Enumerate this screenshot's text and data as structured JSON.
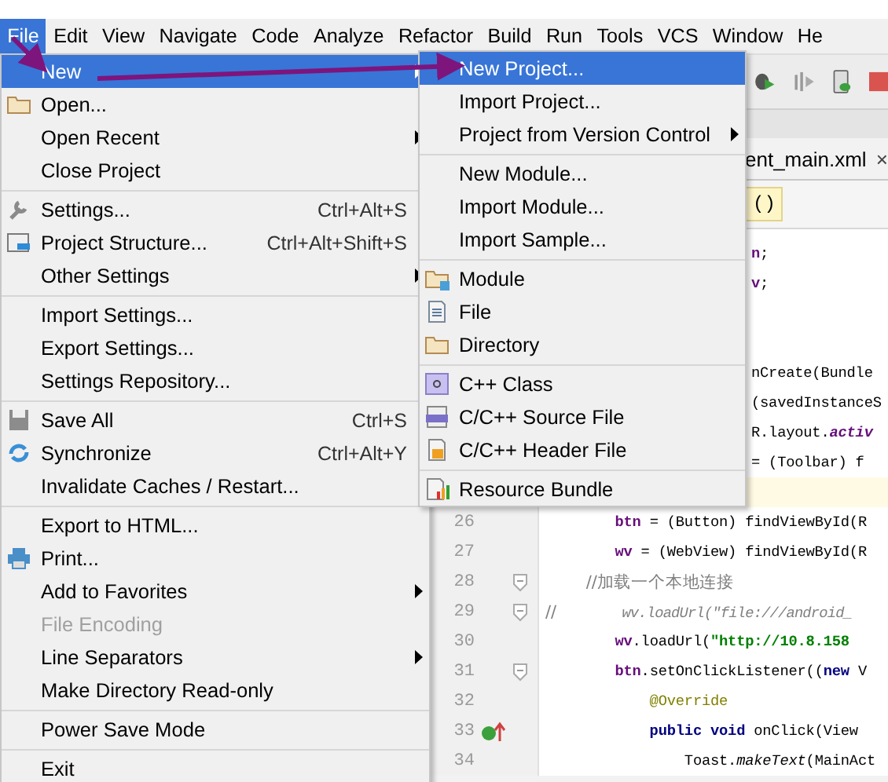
{
  "menu_bar": [
    {
      "label": "File",
      "selected": true
    },
    {
      "label": "Edit",
      "selected": false
    },
    {
      "label": "View",
      "selected": false
    },
    {
      "label": "Navigate",
      "selected": false
    },
    {
      "label": "Code",
      "selected": false
    },
    {
      "label": "Analyze",
      "selected": false
    },
    {
      "label": "Refactor",
      "selected": false
    },
    {
      "label": "Build",
      "selected": false
    },
    {
      "label": "Run",
      "selected": false
    },
    {
      "label": "Tools",
      "selected": false
    },
    {
      "label": "VCS",
      "selected": false
    },
    {
      "label": "Window",
      "selected": false
    },
    {
      "label": "He",
      "selected": false
    }
  ],
  "file_menu": [
    {
      "kind": "item",
      "label": "New",
      "submenu": true,
      "selected": true,
      "disabled": false
    },
    {
      "kind": "item",
      "label": "Open...",
      "selected": false,
      "disabled": false
    },
    {
      "kind": "item",
      "label": "Open Recent",
      "submenu": true,
      "selected": false,
      "disabled": false
    },
    {
      "kind": "item",
      "label": "Close Project",
      "selected": false,
      "disabled": false
    },
    {
      "kind": "separator"
    },
    {
      "kind": "item",
      "label": "Settings...",
      "shortcut": "Ctrl+Alt+S",
      "selected": false,
      "disabled": false
    },
    {
      "kind": "item",
      "label": "Project Structure...",
      "shortcut": "Ctrl+Alt+Shift+S",
      "selected": false,
      "disabled": false
    },
    {
      "kind": "item",
      "label": "Other Settings",
      "submenu": true,
      "selected": false,
      "disabled": false
    },
    {
      "kind": "separator"
    },
    {
      "kind": "item",
      "label": "Import Settings...",
      "selected": false,
      "disabled": false
    },
    {
      "kind": "item",
      "label": "Export Settings...",
      "selected": false,
      "disabled": false
    },
    {
      "kind": "item",
      "label": "Settings Repository...",
      "selected": false,
      "disabled": false
    },
    {
      "kind": "separator"
    },
    {
      "kind": "item",
      "label": "Save All",
      "shortcut": "Ctrl+S",
      "selected": false,
      "disabled": false
    },
    {
      "kind": "item",
      "label": "Synchronize",
      "shortcut": "Ctrl+Alt+Y",
      "selected": false,
      "disabled": false
    },
    {
      "kind": "item",
      "label": "Invalidate Caches / Restart...",
      "selected": false,
      "disabled": false
    },
    {
      "kind": "separator"
    },
    {
      "kind": "item",
      "label": "Export to HTML...",
      "selected": false,
      "disabled": false
    },
    {
      "kind": "item",
      "label": "Print...",
      "selected": false,
      "disabled": false
    },
    {
      "kind": "item",
      "label": "Add to Favorites",
      "submenu": true,
      "selected": false,
      "disabled": false
    },
    {
      "kind": "item",
      "label": "File Encoding",
      "selected": false,
      "disabled": true
    },
    {
      "kind": "item",
      "label": "Line Separators",
      "submenu": true,
      "selected": false,
      "disabled": false
    },
    {
      "kind": "item",
      "label": "Make Directory Read-only",
      "selected": false,
      "disabled": false
    },
    {
      "kind": "separator"
    },
    {
      "kind": "item",
      "label": "Power Save Mode",
      "selected": false,
      "disabled": false
    },
    {
      "kind": "separator"
    },
    {
      "kind": "item",
      "label": "Exit",
      "selected": false,
      "disabled": false
    }
  ],
  "new_submenu": [
    {
      "kind": "item",
      "label": "New Project...",
      "selected": true
    },
    {
      "kind": "item",
      "label": "Import Project...",
      "selected": false
    },
    {
      "kind": "item",
      "label": "Project from Version Control",
      "submenu": true,
      "selected": false
    },
    {
      "kind": "separator"
    },
    {
      "kind": "item",
      "label": "New Module...",
      "selected": false
    },
    {
      "kind": "item",
      "label": "Import Module...",
      "selected": false
    },
    {
      "kind": "item",
      "label": "Import Sample...",
      "selected": false
    },
    {
      "kind": "separator"
    },
    {
      "kind": "item",
      "label": "Module",
      "selected": false
    },
    {
      "kind": "item",
      "label": "File",
      "selected": false
    },
    {
      "kind": "item",
      "label": "Directory",
      "selected": false
    },
    {
      "kind": "separator"
    },
    {
      "kind": "item",
      "label": "C++ Class",
      "selected": false
    },
    {
      "kind": "item",
      "label": "C/C++ Source File",
      "selected": false
    },
    {
      "kind": "item",
      "label": "C/C++ Header File",
      "selected": false
    },
    {
      "kind": "separator"
    },
    {
      "kind": "item",
      "label": "Resource Bundle",
      "selected": false
    }
  ],
  "editor_tab": {
    "label": "ent_main.xml",
    "close": "×"
  },
  "nav_bar": {
    "label": "()"
  },
  "code_lines": [
    {
      "kind": "partial",
      "tokens": [
        {
          "text": "n",
          "kind": "field"
        },
        {
          "text": ";",
          "kind": "plain"
        }
      ]
    },
    {
      "kind": "partial",
      "tokens": [
        {
          "text": "v",
          "kind": "field"
        },
        {
          "text": ";",
          "kind": "plain"
        }
      ]
    },
    {
      "kind": "partial"
    },
    {
      "kind": "partial"
    },
    {
      "kind": "partial",
      "tokens": [
        {
          "text": "nCreate(Bundle",
          "kind": "plain"
        }
      ]
    },
    {
      "kind": "partial",
      "tokens": [
        {
          "text": "(savedInstanceS",
          "kind": "plain"
        }
      ]
    },
    {
      "kind": "partial",
      "tokens": [
        {
          "text": "R.layout.",
          "kind": "plain"
        },
        {
          "text": "activ",
          "kind": "field_italic"
        }
      ]
    },
    {
      "kind": "partial",
      "tokens": [
        {
          "text": "= (Toolbar) f",
          "kind": "plain"
        }
      ]
    },
    {
      "kind": "full",
      "current": true
    },
    {
      "kind": "full",
      "number": "26",
      "tokens": [
        {
          "text": "        btn",
          "kind": "field"
        },
        {
          "text": " = (Button) findViewById(R",
          "kind": "plain"
        }
      ]
    },
    {
      "kind": "full",
      "number": "27",
      "tokens": [
        {
          "text": "        wv",
          "kind": "field"
        },
        {
          "text": " = (WebView) findViewById(R",
          "kind": "plain"
        }
      ]
    },
    {
      "kind": "full",
      "number": "28",
      "fold": true,
      "tokens": [
        {
          "text": "        //加载一个本地连接",
          "kind": "comment"
        }
      ]
    },
    {
      "kind": "full",
      "number": "29",
      "fold": true,
      "tokens": [
        {
          "text": "//",
          "kind": "comment"
        },
        {
          "text": "        wv.loadUrl(\"file:///android_",
          "kind": "comment_italic"
        }
      ]
    },
    {
      "kind": "full",
      "number": "30",
      "tokens": [
        {
          "text": "        wv",
          "kind": "field"
        },
        {
          "text": ".loadUrl(",
          "kind": "plain"
        },
        {
          "text": "\"http://10.8.158",
          "kind": "string"
        }
      ]
    },
    {
      "kind": "full",
      "number": "31",
      "fold": true,
      "tokens": [
        {
          "text": "        btn",
          "kind": "field"
        },
        {
          "text": ".setOnClickListener((",
          "kind": "plain"
        },
        {
          "text": "new",
          "kind": "keyword"
        },
        {
          "text": " V",
          "kind": "plain"
        }
      ]
    },
    {
      "kind": "full",
      "number": "32",
      "tokens": [
        {
          "text": "            @Override",
          "kind": "annotation"
        }
      ]
    },
    {
      "kind": "full",
      "number": "33",
      "marker": true,
      "tokens": [
        {
          "text": "            public void",
          "kind": "keyword"
        },
        {
          "text": " onClick(View",
          "kind": "plain"
        }
      ]
    },
    {
      "kind": "full",
      "number": "34",
      "tokens": [
        {
          "text": "                Toast.",
          "kind": "plain"
        },
        {
          "text": "makeText",
          "kind": "italic"
        },
        {
          "text": "(MainAct",
          "kind": "plain"
        }
      ]
    }
  ]
}
